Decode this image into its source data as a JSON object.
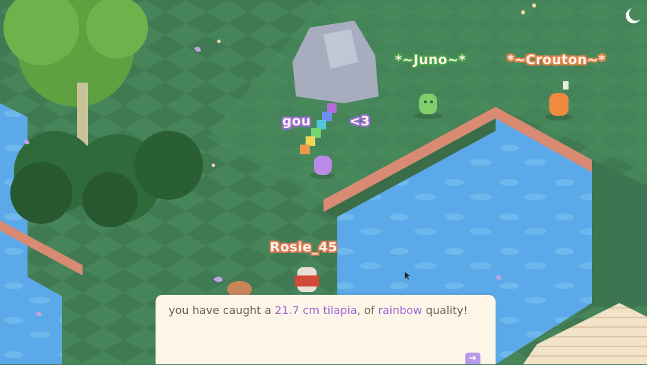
{
  "players": [
    {
      "name": "*~Juno~*",
      "color": "#4aa04a"
    },
    {
      "name": "*~Crouton~*",
      "color": "#e0824a"
    },
    {
      "name": "Rosie_45",
      "color": "#d87a56"
    },
    {
      "name": "gou",
      "name_suffix": "<3",
      "color": "#9a6fd8"
    }
  ],
  "dialog": {
    "part1": "you have caught a ",
    "size": "21.7 cm",
    "part2": " ",
    "fish": "tilapia",
    "part3": ", of ",
    "quality": "rainbow",
    "part4": " quality!",
    "next_icon": "arrow-right-icon",
    "highlight_color": "#9a5fd6"
  },
  "colors": {
    "grass_dark": "#3f7a52",
    "grass_light": "#4e9160",
    "water": "#5aa8e6",
    "cliff": "#d98a72",
    "dock": "#f0dfc4"
  }
}
